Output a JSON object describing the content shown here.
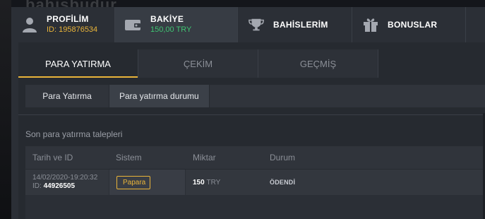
{
  "site": {
    "logo_text": "bahisbudur"
  },
  "top_tabs": [
    {
      "label": "PROFİLİM",
      "sub": "ID: 195876534",
      "icon": "user-icon"
    },
    {
      "label": "BAKİYE",
      "sub": "150,00 TRY",
      "icon": "wallet-icon"
    },
    {
      "label": "BAHİSLERİM",
      "icon": "trophy-icon"
    },
    {
      "label": "BONUSLAR",
      "icon": "gift-icon"
    }
  ],
  "sub_tabs": [
    "PARA YATIRMA",
    "ÇEKİM",
    "GEÇMİŞ"
  ],
  "deposit_tabs": [
    "Para Yatırma",
    "Para yatırma durumu"
  ],
  "section": {
    "title": "Son para yatırma talepleri"
  },
  "table": {
    "headers": [
      "Tarih ve ID",
      "Sistem",
      "Miktar",
      "Durum"
    ],
    "rows": [
      {
        "datetime": "14/02/2020-19:20:32",
        "id_label": "ID:",
        "id": "44926505",
        "system": "Papara",
        "amount": "150",
        "currency": "TRY",
        "status": "ÖDENDİ"
      }
    ]
  },
  "colors": {
    "accent": "#e9b43a",
    "balance_green": "#3fc472",
    "panel": "#2b2f36"
  }
}
